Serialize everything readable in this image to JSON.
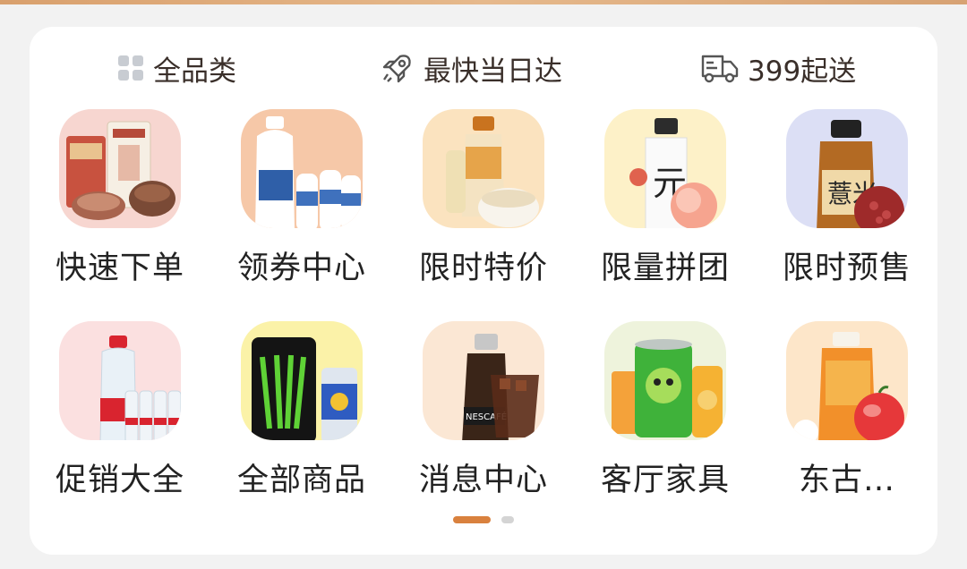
{
  "features": [
    {
      "label": "全品类",
      "icon": "grid-icon"
    },
    {
      "label": "最快当日达",
      "icon": "rocket-icon"
    },
    {
      "label": "399起送",
      "icon": "delivery-truck-icon"
    }
  ],
  "menu": {
    "items": [
      {
        "label": "快速下单",
        "icon": "quick-order-products-image",
        "bg": "#f7d6d0"
      },
      {
        "label": "领券中心",
        "icon": "coupon-milk-drink-image",
        "bg": "#f6c8a8"
      },
      {
        "label": "限时特价",
        "icon": "oat-milk-drink-image",
        "bg": "#fbe3bf"
      },
      {
        "label": "限量拼团",
        "icon": "peach-water-bottle-image",
        "bg": "#fdf1c8"
      },
      {
        "label": "限时预售",
        "icon": "barley-tea-bottle-image",
        "bg": "#dcdff5"
      },
      {
        "label": "促销大全",
        "icon": "water-bottles-image",
        "bg": "#fbe0e0"
      },
      {
        "label": "全部商品",
        "icon": "energy-drink-cans-image",
        "bg": "#fbf2a8"
      },
      {
        "label": "消息中心",
        "icon": "coffee-bottle-image",
        "bg": "#fbe7d4"
      },
      {
        "label": "客厅家具",
        "icon": "juice-cans-image",
        "bg": "#eef3dc"
      },
      {
        "label": "东古…",
        "icon": "apple-juice-bottle-image",
        "bg": "#fde6c9"
      }
    ]
  },
  "pager": {
    "active_index": 0,
    "count": 2
  },
  "colors": {
    "accent": "#d9813e",
    "text": "#222222",
    "card": "#ffffff"
  }
}
